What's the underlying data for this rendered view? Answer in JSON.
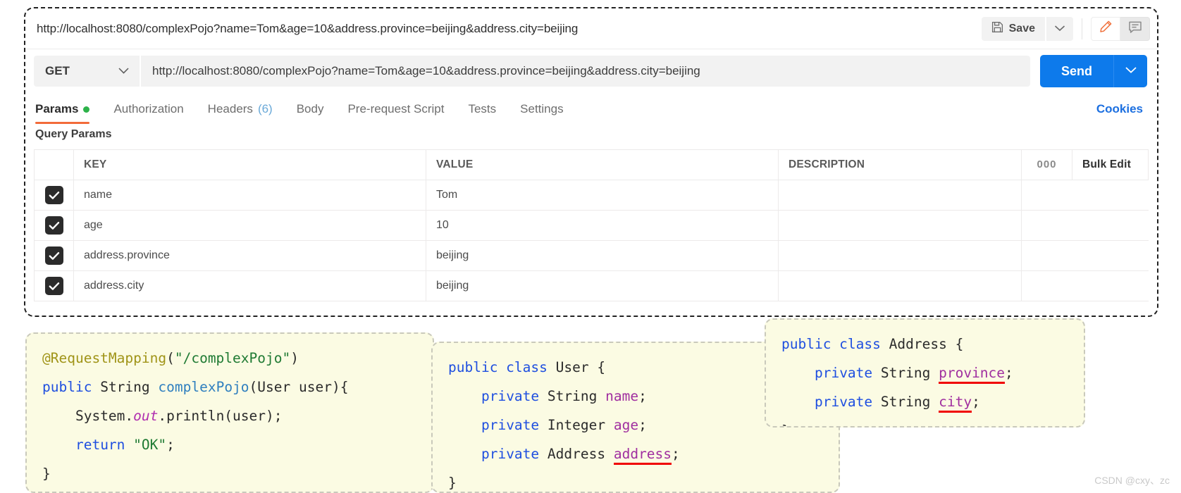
{
  "request": {
    "title": "http://localhost:8080/complexPojo?name=Tom&age=10&address.province=beijing&address.city=beijing",
    "method": "GET",
    "url": "http://localhost:8080/complexPojo?name=Tom&age=10&address.province=beijing&address.city=beijing",
    "save_label": "Save",
    "send_label": "Send"
  },
  "tabs": [
    {
      "label": "Params",
      "badge": "dot",
      "active": true
    },
    {
      "label": "Authorization",
      "badge": "",
      "active": false
    },
    {
      "label": "Headers",
      "badge": "(6)",
      "active": false
    },
    {
      "label": "Body",
      "badge": "",
      "active": false
    },
    {
      "label": "Pre-request Script",
      "badge": "",
      "active": false
    },
    {
      "label": "Tests",
      "badge": "",
      "active": false
    },
    {
      "label": "Settings",
      "badge": "",
      "active": false
    }
  ],
  "cookies_label": "Cookies",
  "params": {
    "section_label": "Query Params",
    "columns": [
      "KEY",
      "VALUE",
      "DESCRIPTION"
    ],
    "more_label": "000",
    "bulk_edit_label": "Bulk Edit",
    "rows": [
      {
        "checked": true,
        "key": "name",
        "value": "Tom",
        "description": ""
      },
      {
        "checked": true,
        "key": "age",
        "value": "10",
        "description": ""
      },
      {
        "checked": true,
        "key": "address.province",
        "value": "beijing",
        "description": ""
      },
      {
        "checked": true,
        "key": "address.city",
        "value": "beijing",
        "description": ""
      }
    ]
  },
  "code": {
    "controller": {
      "line1_anno": "@RequestMapping",
      "line1_open": "(",
      "line1_str": "\"/complexPojo\"",
      "line1_close": ")",
      "line2_kw1": "public",
      "line2_type": "String",
      "line2_fn": "complexPojo",
      "line2_args": "(User user)",
      "line2_brace": "{",
      "line3": "System.",
      "line3_static": "out",
      "line3_rest": ".println(user);",
      "line4_kw": "return",
      "line4_str": "\"OK\"",
      "line4_semi": ";",
      "line5": "}"
    },
    "user": {
      "line1_kw": "public class",
      "line1_name": "User",
      "line1_brace": "{",
      "line2_kw": "private",
      "line2_type": "String",
      "line2_field": "name",
      "line3_kw": "private",
      "line3_type": "Integer",
      "line3_field": "age",
      "line4_kw": "private",
      "line4_type": "Address",
      "line4_field": "address",
      "line5": "}"
    },
    "address": {
      "line1_kw": "public class",
      "line1_name": "Address",
      "line1_brace": "{",
      "line2_kw": "private",
      "line2_type": "String",
      "line2_field": "province",
      "line3_kw": "private",
      "line3_type": "String",
      "line3_field": "city",
      "line4": "}"
    }
  },
  "watermark": "CSDN @cxy、zc",
  "colors": {
    "accent_orange": "#f26b3a",
    "send_blue": "#0d7aeb",
    "link_blue": "#1c6fe0",
    "status_green": "#2db24a",
    "code_bg": "#fbfbe3",
    "underline_red": "#f00000"
  }
}
